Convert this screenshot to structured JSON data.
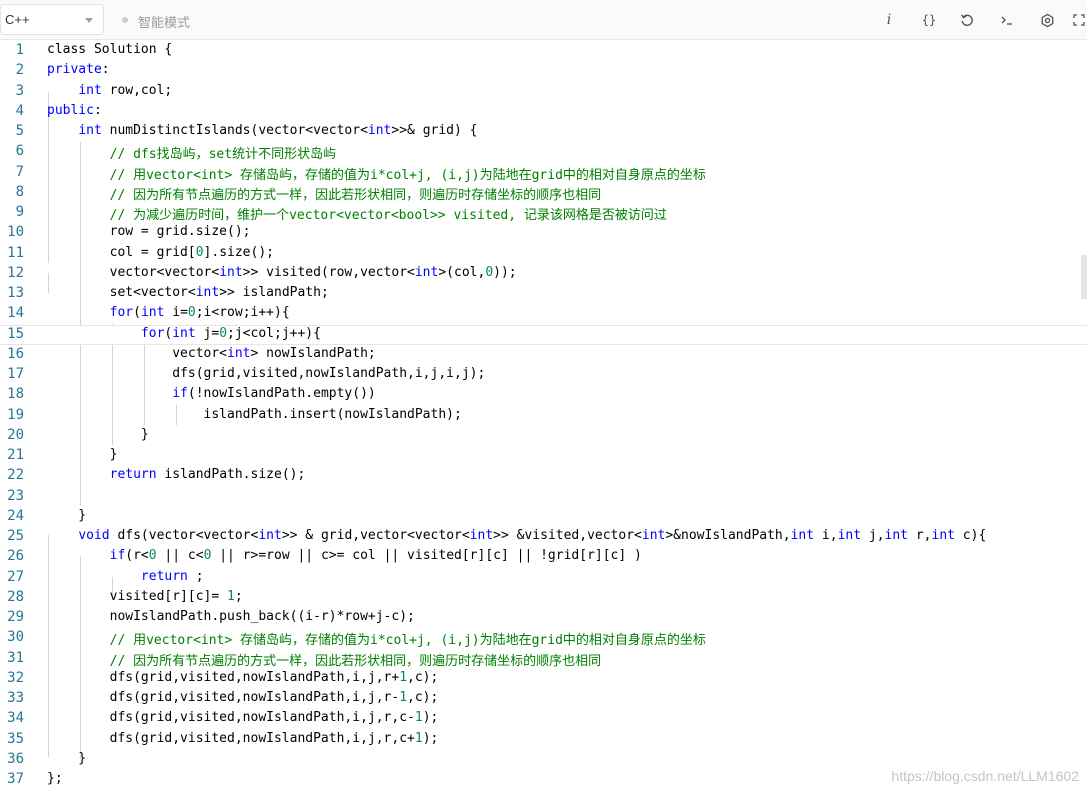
{
  "toolbar": {
    "language": "C++",
    "mode_label": "智能模式",
    "info_icon": "i",
    "format_icon": "{}",
    "colors": {
      "background": "#fafafa",
      "icon": "#555555",
      "mode_text": "#9a9a9a"
    }
  },
  "editor": {
    "active_line": 15,
    "colors": {
      "keyword": "#0000ff",
      "comment": "#008000",
      "number": "#098658",
      "line_number": "#237893",
      "text": "#000000"
    },
    "lines": [
      [
        [
          "class Solution {",
          ""
        ]
      ],
      [
        [
          "private",
          "kw"
        ],
        [
          ":",
          ""
        ]
      ],
      [
        [
          "    ",
          ""
        ],
        [
          "int",
          "kw"
        ],
        [
          " row,col;",
          ""
        ]
      ],
      [
        [
          "public",
          "kw"
        ],
        [
          ":",
          ""
        ]
      ],
      [
        [
          "    ",
          ""
        ],
        [
          "int",
          "kw"
        ],
        [
          " numDistinctIslands(vector<vector<",
          ""
        ],
        [
          "int",
          "kw"
        ],
        [
          ">>& grid) {",
          ""
        ]
      ],
      [
        [
          "        ",
          ""
        ],
        [
          "// dfs找岛屿，set统计不同形状岛屿",
          "cm"
        ]
      ],
      [
        [
          "        ",
          ""
        ],
        [
          "// 用vector<int> 存储岛屿，存储的值为i*col+j, (i,j)为陆地在grid中的相对自身原点的坐标",
          "cm"
        ]
      ],
      [
        [
          "        ",
          ""
        ],
        [
          "// 因为所有节点遍历的方式一样，因此若形状相同，则遍历时存储坐标的顺序也相同",
          "cm"
        ]
      ],
      [
        [
          "        ",
          ""
        ],
        [
          "// 为减少遍历时间，维护一个vector<vector<bool>> visited, 记录该网格是否被访问过",
          "cm"
        ]
      ],
      [
        [
          "        row = grid.size();",
          ""
        ]
      ],
      [
        [
          "        col = grid[",
          ""
        ],
        [
          "0",
          "num"
        ],
        [
          "].size();",
          ""
        ]
      ],
      [
        [
          "        vector<vector<",
          ""
        ],
        [
          "int",
          "kw"
        ],
        [
          ">> visited(row,vector<",
          ""
        ],
        [
          "int",
          "kw"
        ],
        [
          ">(col,",
          ""
        ],
        [
          "0",
          "num"
        ],
        [
          "));",
          ""
        ]
      ],
      [
        [
          "        set<vector<",
          ""
        ],
        [
          "int",
          "kw"
        ],
        [
          ">> islandPath;",
          ""
        ]
      ],
      [
        [
          "        ",
          ""
        ],
        [
          "for",
          "kw"
        ],
        [
          "(",
          ""
        ],
        [
          "int",
          "kw"
        ],
        [
          " i=",
          ""
        ],
        [
          "0",
          "num"
        ],
        [
          ";i<row;i++){",
          ""
        ]
      ],
      [
        [
          "            ",
          ""
        ],
        [
          "for",
          "kw"
        ],
        [
          "(",
          ""
        ],
        [
          "int",
          "kw"
        ],
        [
          " j=",
          ""
        ],
        [
          "0",
          "num"
        ],
        [
          ";j<col;j++){",
          ""
        ]
      ],
      [
        [
          "                vector<",
          ""
        ],
        [
          "int",
          "kw"
        ],
        [
          "> nowIslandPath;",
          ""
        ]
      ],
      [
        [
          "                dfs(grid,visited,nowIslandPath,i,j,i,j);",
          ""
        ]
      ],
      [
        [
          "                ",
          ""
        ],
        [
          "if",
          "kw"
        ],
        [
          "(!nowIslandPath.empty())",
          ""
        ]
      ],
      [
        [
          "                    islandPath.insert(nowIslandPath);",
          ""
        ]
      ],
      [
        [
          "            }",
          ""
        ]
      ],
      [
        [
          "        }",
          ""
        ]
      ],
      [
        [
          "        ",
          ""
        ],
        [
          "return",
          "kw"
        ],
        [
          " islandPath.size();",
          ""
        ]
      ],
      [
        [
          "",
          ""
        ]
      ],
      [
        [
          "    }",
          ""
        ]
      ],
      [
        [
          "    ",
          ""
        ],
        [
          "void",
          "kw"
        ],
        [
          " dfs(vector<vector<",
          ""
        ],
        [
          "int",
          "kw"
        ],
        [
          ">> & grid,vector<vector<",
          ""
        ],
        [
          "int",
          "kw"
        ],
        [
          ">> &visited,vector<",
          ""
        ],
        [
          "int",
          "kw"
        ],
        [
          ">&nowIslandPath,",
          ""
        ],
        [
          "int",
          "kw"
        ],
        [
          " i,",
          ""
        ],
        [
          "int",
          "kw"
        ],
        [
          " j,",
          ""
        ],
        [
          "int",
          "kw"
        ],
        [
          " r,",
          ""
        ],
        [
          "int",
          "kw"
        ],
        [
          " c){",
          ""
        ]
      ],
      [
        [
          "        ",
          ""
        ],
        [
          "if",
          "kw"
        ],
        [
          "(r<",
          ""
        ],
        [
          "0",
          "num"
        ],
        [
          " || c<",
          ""
        ],
        [
          "0",
          "num"
        ],
        [
          " || r>=row || c>= col || visited[r][c] || !grid[r][c] )",
          ""
        ]
      ],
      [
        [
          "            ",
          ""
        ],
        [
          "return",
          "kw"
        ],
        [
          " ;",
          ""
        ]
      ],
      [
        [
          "        visited[r][c]= ",
          ""
        ],
        [
          "1",
          "num"
        ],
        [
          ";",
          ""
        ]
      ],
      [
        [
          "        nowIslandPath.push_back((i-r)*row+j-c);",
          ""
        ]
      ],
      [
        [
          "        ",
          ""
        ],
        [
          "// 用vector<int> 存储岛屿，存储的值为i*col+j, (i,j)为陆地在grid中的相对自身原点的坐标",
          "cm"
        ]
      ],
      [
        [
          "        ",
          ""
        ],
        [
          "// 因为所有节点遍历的方式一样，因此若形状相同，则遍历时存储坐标的顺序也相同",
          "cm"
        ]
      ],
      [
        [
          "        dfs(grid,visited,nowIslandPath,i,j,r+",
          ""
        ],
        [
          "1",
          "num"
        ],
        [
          ",c);",
          ""
        ]
      ],
      [
        [
          "        dfs(grid,visited,nowIslandPath,i,j,r-",
          ""
        ],
        [
          "1",
          "num"
        ],
        [
          ",c);",
          ""
        ]
      ],
      [
        [
          "        dfs(grid,visited,nowIslandPath,i,j,r,c-",
          ""
        ],
        [
          "1",
          "num"
        ],
        [
          ");",
          ""
        ]
      ],
      [
        [
          "        dfs(grid,visited,nowIslandPath,i,j,r,c+",
          ""
        ],
        [
          "1",
          "num"
        ],
        [
          ");",
          ""
        ]
      ],
      [
        [
          "    }",
          ""
        ]
      ],
      [
        [
          "};",
          ""
        ]
      ]
    ]
  },
  "watermark": "https://blog.csdn.net/LLM1602"
}
